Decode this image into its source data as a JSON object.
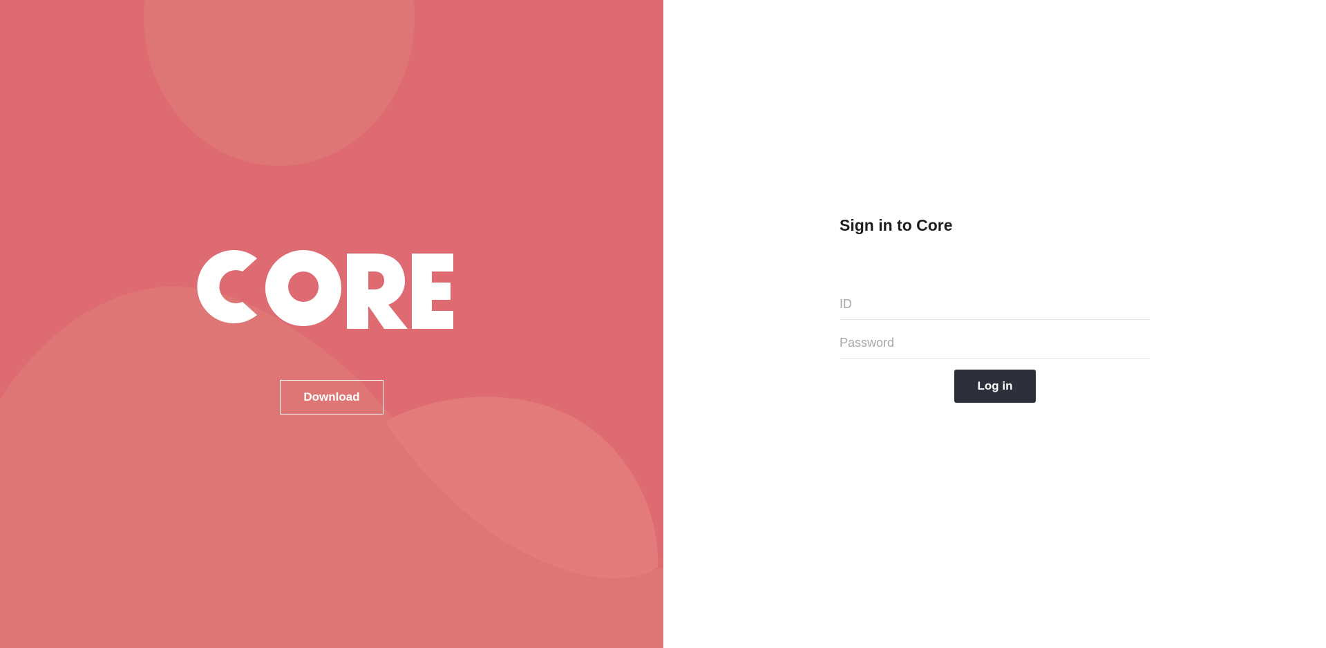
{
  "brand": {
    "logo_text": "CORE",
    "download_label": "Download",
    "background_color": "#de6b72"
  },
  "login": {
    "title": "Sign in to Core",
    "id_placeholder": "ID",
    "password_placeholder": "Password",
    "submit_label": "Log in",
    "button_color": "#2d2f3b"
  }
}
